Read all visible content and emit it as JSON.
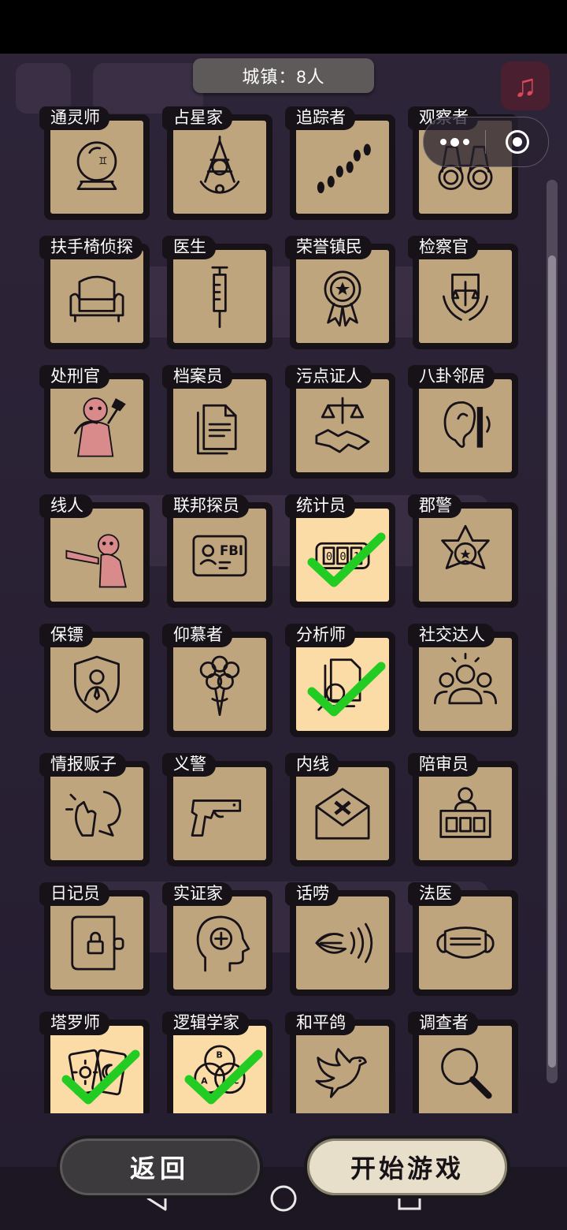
{
  "header": {
    "town_label": "城镇：8人"
  },
  "roles": [
    {
      "name": "通灵师",
      "icon": "crystal-ball-icon",
      "selected": false
    },
    {
      "name": "占星家",
      "icon": "sextant-icon",
      "selected": false
    },
    {
      "name": "追踪者",
      "icon": "footprints-icon",
      "selected": false
    },
    {
      "name": "观察者",
      "icon": "binoculars-icon",
      "selected": false
    },
    {
      "name": "扶手椅侦探",
      "icon": "armchair-icon",
      "selected": false
    },
    {
      "name": "医生",
      "icon": "syringe-icon",
      "selected": false
    },
    {
      "name": "荣誉镇民",
      "icon": "medal-icon",
      "selected": false
    },
    {
      "name": "检察官",
      "icon": "justice-emblem-icon",
      "selected": false
    },
    {
      "name": "处刑官",
      "icon": "axe-figure-icon",
      "selected": false
    },
    {
      "name": "档案员",
      "icon": "documents-icon",
      "selected": false
    },
    {
      "name": "污点证人",
      "icon": "scale-handshake-icon",
      "selected": false
    },
    {
      "name": "八卦邻居",
      "icon": "ear-wall-icon",
      "selected": false
    },
    {
      "name": "线人",
      "icon": "pointing-figure-icon",
      "selected": false
    },
    {
      "name": "联邦探员",
      "icon": "fbi-badge-icon",
      "selected": false
    },
    {
      "name": "统计员",
      "icon": "counter-icon",
      "selected": true
    },
    {
      "name": "郡警",
      "icon": "sheriff-star-icon",
      "selected": false
    },
    {
      "name": "保镖",
      "icon": "bodyguard-shield-icon",
      "selected": false
    },
    {
      "name": "仰慕者",
      "icon": "bouquet-icon",
      "selected": false
    },
    {
      "name": "分析师",
      "icon": "file-search-icon",
      "selected": true
    },
    {
      "name": "社交达人",
      "icon": "crowd-icon",
      "selected": false
    },
    {
      "name": "情报贩子",
      "icon": "whisper-icon",
      "selected": false
    },
    {
      "name": "义警",
      "icon": "pistol-icon",
      "selected": false
    },
    {
      "name": "内线",
      "icon": "envelope-x-icon",
      "selected": false
    },
    {
      "name": "陪审员",
      "icon": "jury-box-icon",
      "selected": false
    },
    {
      "name": "日记员",
      "icon": "locked-diary-icon",
      "selected": false
    },
    {
      "name": "实证家",
      "icon": "head-plus-icon",
      "selected": false
    },
    {
      "name": "话唠",
      "icon": "mouth-sound-icon",
      "selected": false
    },
    {
      "name": "法医",
      "icon": "face-mask-icon",
      "selected": false
    },
    {
      "name": "塔罗师",
      "icon": "tarot-cards-icon",
      "selected": true
    },
    {
      "name": "逻辑学家",
      "icon": "venn-diagram-icon",
      "selected": true
    },
    {
      "name": "和平鸽",
      "icon": "dove-icon",
      "selected": false
    },
    {
      "name": "调查者",
      "icon": "magnifier-icon",
      "selected": false
    }
  ],
  "buttons": {
    "back": "返回",
    "start": "开始游戏"
  },
  "colors": {
    "tile": "#bfa57e",
    "tile_selected": "#fbdca6",
    "check": "#22cc22",
    "frame": "#161218"
  }
}
